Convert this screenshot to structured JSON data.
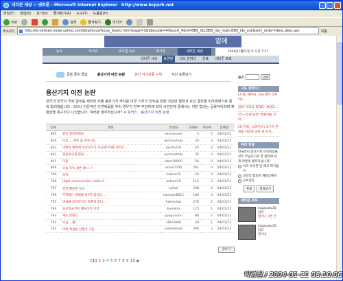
{
  "window": {
    "title": "네티즌 세상 :: 넷토론 - Microsoft Internet Explorer",
    "watermark": "http://www.bcpark.net"
  },
  "menu": [
    "파일(F)",
    "편집(E)",
    "보기(V)",
    "즐겨찾기(A)",
    "도구(T)",
    "도움말(H)"
  ],
  "toolbar": {
    "back": "뒤로",
    "search": "검색",
    "favorites": "즐겨찾기",
    "media": "미디어"
  },
  "address": {
    "label": "주소(D)",
    "url": "http://kr.netizen.news.yahoo.com/bbs/focus/focus_board.html?page=1&bbscode=45&sort_field=BBS_idx,BBS_idx_main,BBS_idx_sub&sort_order=desc,desc,asc",
    "go": "이동"
  },
  "banner": {
    "text": "밑에"
  },
  "nav1": [
    "뉴스",
    "포커스",
    "비즈업 뉴스",
    "헤가전",
    "네티즌 세상",
    "",
    ""
  ],
  "nav1_date": "2004년1월21일 수 오전 7:47",
  "nav2": [
    "네티즌 세상",
    "토론방",
    "나도 한마디",
    "한표",
    "네티즌 포토"
  ],
  "subnav": [
    "글쓸 준비 특집",
    "용산기지 이전 논란",
    "양산 낙선운동 시위",
    "지난 토론보기"
  ],
  "page": {
    "title": "용산기지 이전 논란",
    "intro": "한국과 미국이 국회 일부를 제외한 서울 용산기지 부지를 미군 기지의 전부를 반환 이남반 협력과 요산 결자을 미라엔에기로 원칙 합의했습니다. 그러나 전문적인 이견에들을 주리 경우가 전부 부담하게 되어 시민단체 중에서는 이번 합의는 굴욕적이라며 재협상을 촉구하고 나섰습니다. 여러분 생각하십니까?",
    "intro_link": "※ 포커스 : 용산기지 이전 논란"
  },
  "table": {
    "headers": [
      "번호",
      "제목",
      "작성자",
      "조회수",
      "추천수",
      "등록일"
    ],
    "rows": [
      [
        "805",
        "같이 힐러지버요",
        "zelchensail",
        "5",
        "0",
        "04/01/21"
      ],
      [
        "804",
        "아휴.....제목 좀 바꾸시오.",
        "winmoshoki",
        "35",
        "0",
        "04/01/21"
      ],
      [
        "803",
        "미래의 평화에 누리나라가 미군재기지를 바라는....",
        "jaechul10",
        "45",
        "0",
        "04/01/21"
      ],
      [
        "802",
        "밀감쇼차게 현실....",
        "winmoshoki",
        "35",
        "0",
        "04/01/21"
      ],
      [
        "801",
        "다뭔",
        "siber30800",
        "56",
        "0",
        "04/01/21"
      ],
      [
        "800",
        "오늘 똑똑 글쓴 합니..!!",
        "acom7700",
        "241",
        "0",
        "04/01/21"
      ],
      [
        "799",
        "허허",
        "kokore19",
        "24",
        "0",
        "04/01/21"
      ],
      [
        "798",
        "[light communists, radio li...",
        "kokore19",
        "115",
        "3",
        "04/01/21"
      ],
      [
        "797",
        "정말 황당한 것이....",
        "nyltoh",
        "208",
        "0",
        "04/01/21"
      ],
      [
        "796",
        "부자되는 방법을 알려드립니다...",
        "hannam8011",
        "100",
        "0",
        "04/01/21"
      ],
      [
        "795",
        "미국을 끌어안다고 자존과 있나...",
        "hwhechat",
        "278",
        "2",
        "04/01/21"
      ],
      [
        "794",
        "용산미군기지 황당이유 이전",
        "kyuinkim",
        "125",
        "1",
        "04/01/21"
      ],
      [
        "793",
        "계도 반대다",
        "ypugunnnn",
        "88",
        "2",
        "04/01/21"
      ],
      [
        "792",
        "보심....활!",
        "s9br2008",
        "49",
        "1",
        "04/01/21"
      ],
      [
        "791",
        "이와 작성을 선행곡 고민",
        "nishinkorea",
        "290",
        "2",
        "04/01/21"
      ]
    ]
  },
  "write_button": "글쓰기",
  "pager": {
    "pages": [
      "[1]",
      "2",
      "3",
      "4",
      "5",
      "6",
      "7",
      "8",
      "9",
      "10",
      "▶"
    ]
  },
  "sidebar": {
    "search_label": "뉴스",
    "search_button": "검색",
    "hanmadi_title": "나도 한마디!",
    "hanmadi_items": [
      "[사설] 베트남, 미국 별아 선처터드...",
      "꿈에 '미리크 필레다' 세살고...",
      "25~35세 남성 '연출이들' 은어...",
      "[고구려는 삼마진다] 고구려 관계를 미렁에 보여 게 관가..."
    ],
    "poll_title": "이이 한표",
    "poll_question": "한국측이 용산기지 이전비용을 전부 부담하기로 한 합의에 대해 어떻게 생각하십니까?",
    "poll_options": [
      "이미 약속한 일 재고 여기없어",
      "굴욕적 합의로 재협상해야",
      "모르겠다"
    ],
    "poll_vote": "투표",
    "poll_result": "결과보기",
    "photo_title": "네티즌 포토",
    "photos": [
      {
        "user": "kagayaku35",
        "suffix": "님의",
        "caption": "벌이녀 고른 은"
      },
      {
        "user": "kagayaku35",
        "suffix": "님의",
        "caption": "벌이네"
      }
    ]
  },
  "signature": "박병철 / 2004-01-21 08:10:06"
}
